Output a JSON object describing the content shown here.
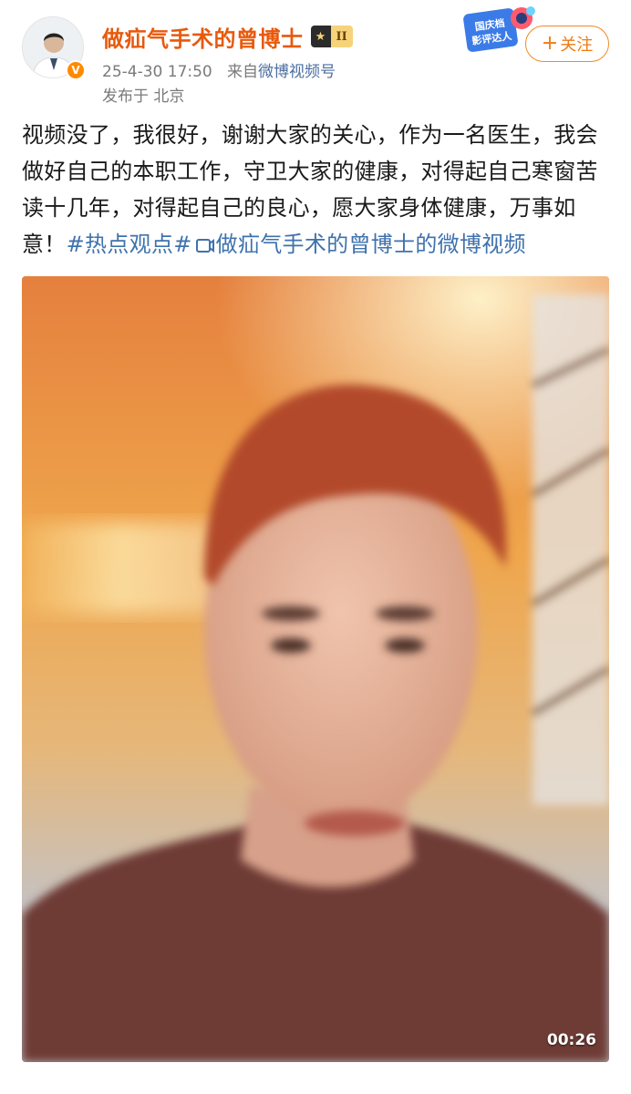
{
  "user": {
    "name": "做疝气手术的曾博士",
    "level": "II",
    "verified_mark": "V",
    "timestamp": "25-4-30 17:50",
    "source_prefix": "来自",
    "source": "微博视频号",
    "location": "发布于 北京"
  },
  "event_badge": {
    "line1": "国庆档",
    "line2": "影评达人"
  },
  "follow": {
    "label": "关注",
    "plus": "+"
  },
  "post": {
    "text": "视频没了，我很好，谢谢大家的关心，作为一名医生，我会做好自己的本职工作，守卫大家的健康，对得起自己寒窗苦读十几年，对得起自己的良心，愿大家身体健康，万事如意！",
    "hashtag": "#热点观点#",
    "video_link": "做疝气手术的曾博士的微博视频"
  },
  "video": {
    "duration": "00:26"
  },
  "colors": {
    "name": "#e8590c",
    "link": "#3f72ad",
    "follow": "#f07a10",
    "meta": "#7a7a7a"
  }
}
